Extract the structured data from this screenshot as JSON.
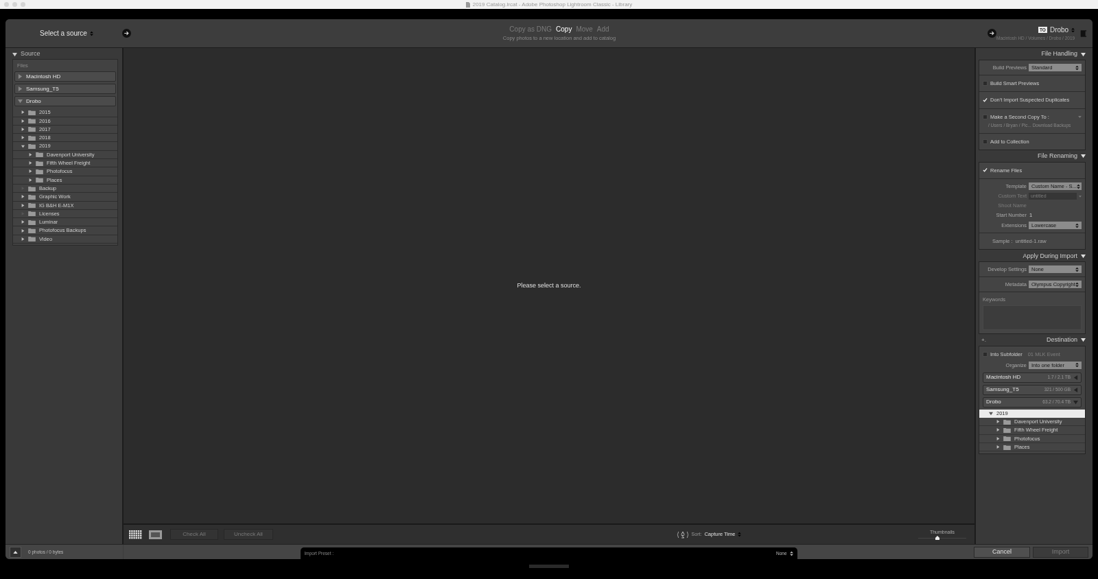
{
  "title_bar": {
    "title": "2019 Catalog.lrcat - Adobe Photoshop Lightroom Classic - Library"
  },
  "header": {
    "source": "Select a source",
    "modes": [
      {
        "label": "Copy as DNG",
        "selected": false
      },
      {
        "label": "Copy",
        "selected": true
      },
      {
        "label": "Move",
        "selected": false
      },
      {
        "label": "Add",
        "selected": false
      }
    ],
    "mode_description": "Copy photos to a new location and add to catalog",
    "destination": {
      "badge": "TO",
      "name": "Drobo",
      "path": "Macintosh HD / Volumes / Drobo / 2019"
    }
  },
  "source_panel": {
    "title": "Source",
    "section": "Files",
    "devices": [
      {
        "name": "Macintosh HD",
        "expanded": false
      },
      {
        "name": "Samsung_T5",
        "expanded": false
      },
      {
        "name": "Drobo",
        "expanded": true,
        "children": [
          {
            "name": "2015",
            "expandable": true,
            "expanded": false
          },
          {
            "name": "2016",
            "expandable": true,
            "expanded": false
          },
          {
            "name": "2017",
            "expandable": true,
            "expanded": false
          },
          {
            "name": "2018",
            "expandable": true,
            "expanded": false
          },
          {
            "name": "2019",
            "expandable": true,
            "expanded": true,
            "children": [
              {
                "name": "Davenport University",
                "expandable": true,
                "expanded": false
              },
              {
                "name": "Fifth Wheel Freight",
                "expandable": true,
                "expanded": false
              },
              {
                "name": "Photofocus",
                "expandable": true,
                "expanded": false
              },
              {
                "name": "Places",
                "expandable": true,
                "expanded": false
              }
            ]
          },
          {
            "name": "Backup",
            "expandable": false
          },
          {
            "name": "Graphic Work",
            "expandable": true,
            "expanded": false
          },
          {
            "name": "IG B&H E-M1X",
            "expandable": true,
            "expanded": false
          },
          {
            "name": "Licenses",
            "expandable": false
          },
          {
            "name": "Luminar",
            "expandable": true,
            "expanded": false
          },
          {
            "name": "Photofocus Backups",
            "expandable": true,
            "expanded": false
          },
          {
            "name": "Video",
            "expandable": true,
            "expanded": false
          }
        ]
      }
    ]
  },
  "message": "Please select a source.",
  "toolbar": {
    "check_all": "Check All",
    "uncheck_all": "Uncheck All",
    "sort_label": "Sort:",
    "sort_value": "Capture Time",
    "thumbnails_label": "Thumbnails",
    "level": 0.4
  },
  "sections": [
    {
      "title": "File Handling",
      "groups": [
        [
          {
            "kind": "select",
            "label": "Build Previews",
            "value": "Standard"
          }
        ],
        [
          {
            "kind": "checkbox",
            "label": "Build Smart Previews",
            "checked": false
          }
        ],
        [
          {
            "kind": "checkbox",
            "label": "Don't Import Suspected Duplicates",
            "checked": true
          }
        ],
        [
          {
            "kind": "checkbox",
            "label": "Make a Second Copy To :",
            "checked": false,
            "path": "/ Users / Bryan / Pic... Download Backups"
          }
        ],
        [
          {
            "kind": "checkbox",
            "label": "Add to Collection",
            "checked": false
          }
        ]
      ]
    },
    {
      "title": "File Renaming",
      "groups": [
        [
          {
            "kind": "checkbox",
            "label": "Rename Files",
            "checked": true
          }
        ],
        [
          {
            "kind": "select",
            "label": "Template",
            "value": "Custom Name - S..."
          },
          {
            "kind": "field",
            "label": "Custom Text",
            "placeholder": "untitled",
            "disabled": true
          },
          {
            "kind": "text",
            "label": "Shoot Name",
            "disabled": true
          },
          {
            "kind": "text",
            "label": "Start Number",
            "value": "1",
            "disabled": false
          },
          {
            "kind": "select",
            "label": "Extensions",
            "value": "Lowercase"
          }
        ],
        [
          {
            "kind": "sample",
            "label": "Sample :",
            "value": "untitled-1.raw"
          }
        ]
      ]
    },
    {
      "title": "Apply During Import",
      "groups": [
        [
          {
            "kind": "select",
            "label": "Develop Settings",
            "value": "None"
          }
        ],
        [
          {
            "kind": "select",
            "label": "Metadata",
            "value": "Olympus Copyright"
          }
        ],
        [
          {
            "kind": "keywords",
            "label": "Keywords"
          }
        ]
      ]
    },
    {
      "title": "Destination",
      "add": "+.",
      "groups": [
        [
          {
            "kind": "checkbox",
            "label": "Into Subfolder",
            "checked": false,
            "value": "01 MLK Event"
          },
          {
            "kind": "select",
            "label": "Organize",
            "value": "Into one folder"
          },
          {
            "kind": "drive",
            "label": "Macintosh HD",
            "value": "1.7 / 2.1 TB",
            "expanded": false
          },
          {
            "kind": "drive",
            "label": "Samsung_T5",
            "value": "321 / 500 GB",
            "expanded": false
          },
          {
            "kind": "drive",
            "label": "Drobo",
            "value": "63.2 / 70.4 TB",
            "expanded": true,
            "children": [
              {
                "name": "2019",
                "expanded": true,
                "selected": true,
                "children": [
                  {
                    "name": "Davenport University",
                    "expanded": false,
                    "selected": false
                  },
                  {
                    "name": "Fifth Wheel Freight",
                    "expanded": false,
                    "selected": false
                  },
                  {
                    "name": "Photofocus",
                    "expanded": false,
                    "selected": false
                  },
                  {
                    "name": "Places",
                    "expanded": false,
                    "selected": false
                  }
                ]
              }
            ]
          }
        ]
      ]
    }
  ],
  "footer": {
    "count": "0 photos / 0 bytes",
    "preset_label": "Import Preset :",
    "preset_value": "None",
    "cancel": "Cancel",
    "import": "Import"
  }
}
